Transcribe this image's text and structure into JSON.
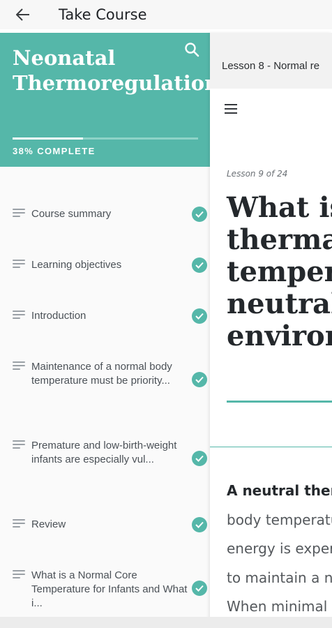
{
  "appbar": {
    "title": "Take Course"
  },
  "course": {
    "title": "Neonatal Thermoregulation",
    "progress": 0.38,
    "progress_label": "38% COMPLETE"
  },
  "lessons": [
    {
      "label": "Course summary",
      "completed": true
    },
    {
      "label": "Learning objectives",
      "completed": true
    },
    {
      "label": "Introduction",
      "completed": true
    },
    {
      "label": "Maintenance of a normal body temperature must be priority...",
      "completed": true
    },
    {
      "label": "Premature and low-birth-weight infants are especially vul...",
      "completed": true
    },
    {
      "label": "Review",
      "completed": true
    },
    {
      "label": "What is a Normal Core Temperature for Infants and What i...",
      "completed": true
    }
  ],
  "content": {
    "lesson_bar": "Lesson 8 - Normal re",
    "lesson_count": "Lesson 9 of 24",
    "heading_lines": [
      "What is",
      "therma",
      "temper",
      "neutral",
      "environ"
    ],
    "body_lines": [
      {
        "strong": "A neutral ther",
        "text": ""
      },
      {
        "strong": "",
        "text": "body temperatu"
      },
      {
        "strong": "",
        "text": "energy is exper"
      },
      {
        "strong": "",
        "text": "to maintain a n"
      },
      {
        "strong": "",
        "text": "When minimal"
      }
    ]
  },
  "colors": {
    "accent": "#55b7a9",
    "accent_light": "#8ed3c8"
  },
  "icons": {
    "back": "arrow-left-icon",
    "search": "search-icon",
    "lesson": "lines-icon",
    "check": "check-circle-icon",
    "menu": "hamburger-icon"
  }
}
